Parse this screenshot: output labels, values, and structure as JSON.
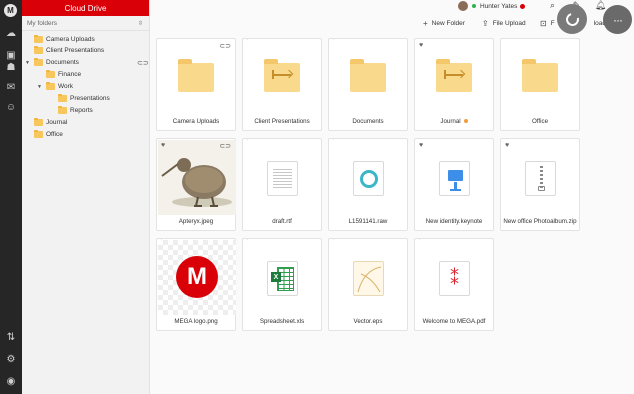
{
  "app": {
    "title": "Cloud Drive"
  },
  "tree": {
    "header": "My folders",
    "nodes": [
      {
        "label": "Camera Uploads"
      },
      {
        "label": "Client Presentations"
      },
      {
        "label": "Documents"
      },
      {
        "label": "Finance"
      },
      {
        "label": "Work"
      },
      {
        "label": "Presentations"
      },
      {
        "label": "Reports"
      },
      {
        "label": "Journal"
      },
      {
        "label": "Office"
      }
    ]
  },
  "topbar": {
    "user_name": "Hunter Yates",
    "new_folder": "New Folder",
    "file_upload": "File Upload",
    "folder_upload_partial": "F",
    "folder_upload_tail": "load"
  },
  "files": [
    {
      "name": "Camera Uploads"
    },
    {
      "name": "Client Presentations"
    },
    {
      "name": "Documents"
    },
    {
      "name": "Journal"
    },
    {
      "name": "Office"
    },
    {
      "name": "Apteryx.jpeg"
    },
    {
      "name": "draft.rtf"
    },
    {
      "name": "L1591141.raw"
    },
    {
      "name": "New identity.keynote"
    },
    {
      "name": "New office Photoalbum.zip"
    },
    {
      "name": "MEGA logo.png"
    },
    {
      "name": "Spreadsheet.xls"
    },
    {
      "name": "Vector.eps"
    },
    {
      "name": "Welcome to MEGA.pdf"
    }
  ],
  "colors": {
    "brand": "#d90007",
    "rail": "#262626",
    "folder": "#f9d98b"
  }
}
